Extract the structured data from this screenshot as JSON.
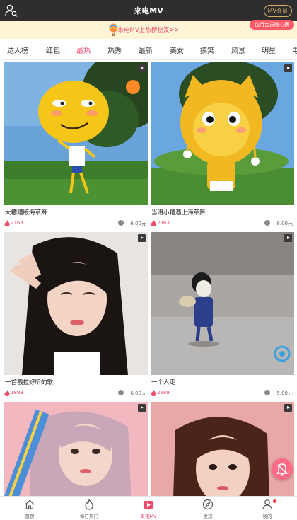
{
  "header": {
    "title": "来电MV",
    "vip_label": "MV会员"
  },
  "promo": {
    "text": "来电MV上热榜秘笈>>",
    "tag": "包月会员随心换"
  },
  "tabs": [
    {
      "label": "达人榜",
      "active": false
    },
    {
      "label": "红包",
      "active": false
    },
    {
      "label": "最热",
      "active": true
    },
    {
      "label": "热秀",
      "active": false
    },
    {
      "label": "最新",
      "active": false
    },
    {
      "label": "美女",
      "active": false
    },
    {
      "label": "搞笑",
      "active": false
    },
    {
      "label": "风景",
      "active": false
    },
    {
      "label": "明星",
      "active": false
    },
    {
      "label": "电",
      "active": false
    }
  ],
  "cards": [
    {
      "title": "大糟糟版海草舞",
      "likes": "2163",
      "price": "6.00元"
    },
    {
      "title": "当滑小糟遇上海草舞",
      "likes": "2963",
      "price": "6.00元"
    },
    {
      "title": "一首戳拉好听的歌",
      "likes": "1893",
      "price": "6.00元"
    },
    {
      "title": "一个人走",
      "likes": "2589",
      "price": "5.00元"
    },
    {
      "title": "",
      "likes": "",
      "price": ""
    },
    {
      "title": "",
      "likes": "",
      "price": ""
    }
  ],
  "bottom_nav": [
    {
      "label": "首页",
      "icon": "home-icon",
      "active": false
    },
    {
      "label": "每日热门",
      "icon": "flame-icon",
      "active": false
    },
    {
      "label": "来电MV",
      "icon": "mv-icon",
      "active": true
    },
    {
      "label": "发现",
      "icon": "compass-icon",
      "active": false
    },
    {
      "label": "我的",
      "icon": "person-icon",
      "active": false
    }
  ],
  "colors": {
    "accent": "#f04a6c",
    "header_bg": "#2f2d2e",
    "promo_bg": "#fff5d6",
    "vip_gold": "#d7b16b"
  }
}
